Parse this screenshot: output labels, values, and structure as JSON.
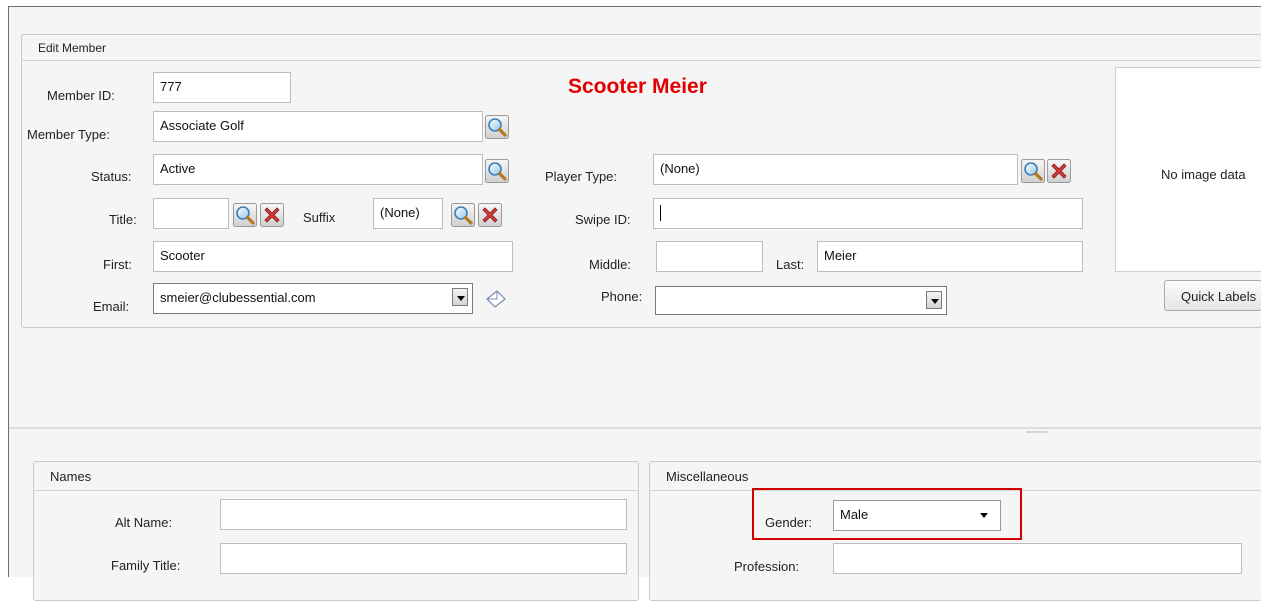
{
  "edit_member": {
    "title": "Edit Member",
    "member_name": "Scooter Meier",
    "member_id": {
      "label": "Member ID:",
      "value": "777"
    },
    "member_type": {
      "label": "Member Type:",
      "value": "Associate Golf"
    },
    "status": {
      "label": "Status:",
      "value": "Active"
    },
    "title_field": {
      "label": "Title:",
      "value": ""
    },
    "suffix": {
      "label": "Suffix",
      "value": "(None)"
    },
    "first": {
      "label": "First:",
      "value": "Scooter"
    },
    "email": {
      "label": "Email:",
      "value": "smeier@clubessential.com"
    },
    "player_type": {
      "label": "Player Type:",
      "value": "(None)"
    },
    "swipe_id": {
      "label": "Swipe ID:",
      "value": ""
    },
    "middle": {
      "label": "Middle:",
      "value": ""
    },
    "last": {
      "label": "Last:",
      "value": "Meier"
    },
    "phone": {
      "label": "Phone:",
      "value": ""
    },
    "image_placeholder": "No image data",
    "quick_label_button": "Quick Labels"
  },
  "names": {
    "title": "Names",
    "alt_name": {
      "label": "Alt Name:",
      "value": ""
    },
    "family_title": {
      "label": "Family Title:",
      "value": ""
    }
  },
  "misc": {
    "title": "Miscellaneous",
    "gender": {
      "label": "Gender:",
      "value": "Male"
    },
    "profession": {
      "label": "Profession:",
      "value": ""
    }
  },
  "icons": {
    "lookup": "magnifier-icon",
    "clear": "red-x-icon",
    "email_send": "envelope-icon"
  },
  "colors": {
    "member_name": "#e00000",
    "highlight": "#d40000"
  }
}
